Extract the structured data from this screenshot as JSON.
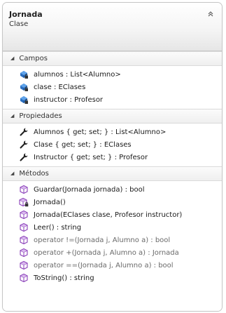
{
  "class": {
    "name": "Jornada",
    "stereotype": "Clase"
  },
  "colors": {
    "field_icon": "#2a6fc1",
    "method_icon": "#8a3fb8",
    "wrench": "#222222"
  },
  "sections": [
    {
      "label": "Campos",
      "items": [
        {
          "text": "alumnos : List<Alumno>",
          "icon": "private-field-icon"
        },
        {
          "text": "clase : EClases",
          "icon": "private-field-icon"
        },
        {
          "text": "instructor : Profesor",
          "icon": "private-field-icon"
        }
      ]
    },
    {
      "label": "Propiedades",
      "items": [
        {
          "text": "Alumnos { get; set; } : List<Alumno>",
          "icon": "property-wrench-icon"
        },
        {
          "text": "Clase { get; set; } : EClases",
          "icon": "property-wrench-icon"
        },
        {
          "text": "Instructor { get; set; } : Profesor",
          "icon": "property-wrench-icon"
        }
      ]
    },
    {
      "label": "Métodos",
      "items": [
        {
          "text": "Guardar(Jornada jornada) : bool",
          "icon": "method-icon"
        },
        {
          "text": "Jornada()",
          "icon": "private-method-icon"
        },
        {
          "text": "Jornada(EClases clase, Profesor instructor)",
          "icon": "method-icon"
        },
        {
          "text": "Leer() : string",
          "icon": "method-icon"
        },
        {
          "text": "operator !=(Jornada j, Alumno a) : bool",
          "icon": "method-icon",
          "muted": true
        },
        {
          "text": "operator +(Jornada j, Alumno a) : Jornada",
          "icon": "method-icon",
          "muted": true
        },
        {
          "text": "operator ==(Jornada j, Alumno a) : bool",
          "icon": "method-icon",
          "muted": true
        },
        {
          "text": "ToString() : string",
          "icon": "method-icon"
        }
      ]
    }
  ]
}
